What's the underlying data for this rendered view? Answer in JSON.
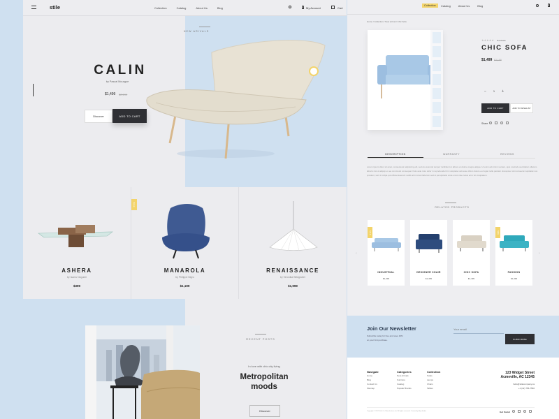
{
  "left": {
    "logo": "stile",
    "nav": [
      "Collection",
      "Catalog",
      "About Us",
      "Blog"
    ],
    "account": "My Account",
    "cart": "Cart",
    "new_arrivals": "NEW ARIVALS",
    "hero": {
      "name": "CALIN",
      "by": "by Pascal Mourgue",
      "price": "$1,499",
      "old_price": "$2,199",
      "discover": "Discover",
      "add_to_cart": "ADD TO CART"
    },
    "products": [
      {
        "name": "ASHERA",
        "by": "by Isamu Noguchi",
        "price": "$399"
      },
      {
        "name": "MANAROLA",
        "by": "by Philippe Nigro",
        "price": "$1,199",
        "tag": "SALE"
      },
      {
        "name": "RENAISSANCE",
        "by": "by Veronika Wildgruber",
        "price": "$1,999"
      }
    ],
    "recent_posts": "RECENT POSTS",
    "post": {
      "kicker": "In love with chic city living",
      "title_line1": "Metropolitan",
      "title_line2": "moods",
      "discover": "Discover"
    }
  },
  "right": {
    "nav": [
      "Collection",
      "Catalog",
      "About Us",
      "Blog"
    ],
    "breadcrumb": "Home  /  Collection  /  New arrival  /  Chic Sofa",
    "reviews": "5 reviews",
    "name": "CHIC SOFA",
    "price": "$1,499",
    "old_price": "$2,199",
    "qty": "1",
    "add_to_cart": "ADD TO CART",
    "wishlist": "ADD TO WISHLIST",
    "share": "Share",
    "tabs": [
      "DESCRIPTION",
      "WARRANTY",
      "REVIEWS"
    ],
    "description": "Lorem ipsum dolor sit amet, consectetur adipiscing elit, sed do eiusmod tempor incididunt ut labore et dolore magna aliqua. Ut enim ad minim veniam, quis nostrud exercitation ullamco laboris nisi ut aliquip ex ea commodo consequat. Duis aute irure dolor in reprehenderit in voluptate velit esse cillum dolore eu fugiat nulla pariatur. Excepteur sint occaecat cupidatat non proident, sunt in culpa qui officia deserunt mollit anim id est laborum sed ut perspiciatis unde omnis iste natus error sit voluptatem.",
    "related": "RELATED PRODUCTS",
    "related_items": [
      {
        "name": "INDUSTRIAL",
        "price": "$1,499",
        "tag": "SALE"
      },
      {
        "name": "DESIGNER CHAIR",
        "price": "$1,499"
      },
      {
        "name": "CHIC SOFA",
        "price": "$1,499"
      },
      {
        "name": "FASHION",
        "price": "$1,499",
        "tag": "NEW"
      }
    ],
    "newsletter": {
      "title": "Join Our Newsletter",
      "text1": "Subscribe today for free and save 10%",
      "text2": "on your first purchase.",
      "placeholder": "Your email",
      "button": "SUBSCRIBE"
    },
    "footer": {
      "navigate": {
        "title": "Navigate",
        "items": [
          "Home",
          "Blog",
          "Contact Us",
          "Sitemap"
        ]
      },
      "categories": {
        "title": "Categories",
        "items": [
          "New Arrivals",
          "Furniture",
          "Catalog",
          "Popular Brands"
        ]
      },
      "collection": {
        "title": "Collection",
        "items": [
          "Sofas",
          "Lamps",
          "Chairs",
          "Tables"
        ]
      },
      "address1": "123 Widget Street",
      "address2": "Acmeville, AC 12345",
      "email": "hello@stilecompany.ca",
      "phone": "+1 (12) 756-7566",
      "copyright": "Copyright © 2017 Stile Co. Manufacturer Inc. All rights reserved. Created by Bog Studio",
      "social": "Get Social"
    }
  },
  "colors": {
    "accent": "#f3d46b",
    "dark": "#2f3034",
    "blue": "#cfe0f0",
    "chair_blue": "#3f5a92",
    "teal": "#3cb3c4",
    "sofa_blue": "#a8c8e6"
  }
}
